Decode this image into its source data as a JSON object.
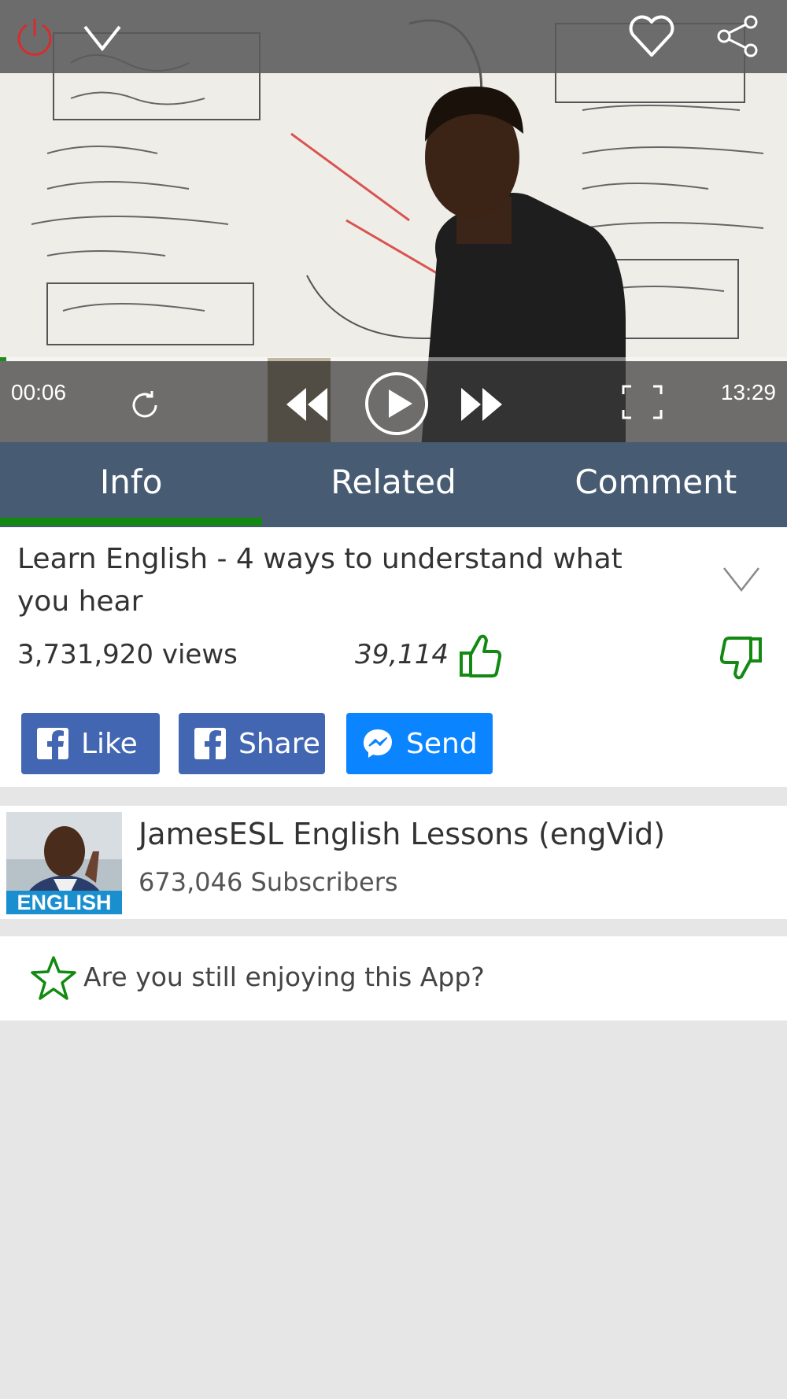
{
  "player": {
    "time_elapsed": "00:06",
    "time_total": "13:29",
    "progress_fraction": 0.008,
    "icons": {
      "power": "power-icon",
      "collapse": "chevron-down-icon",
      "favorite": "heart-icon",
      "share": "share-icon",
      "replay": "replay-icon",
      "rewind": "rewind-icon",
      "play": "play-icon",
      "forward": "fast-forward-icon",
      "fullscreen": "fullscreen-icon"
    }
  },
  "tabs": [
    {
      "label": "Info",
      "active": true
    },
    {
      "label": "Related",
      "active": false
    },
    {
      "label": "Comment",
      "active": false
    }
  ],
  "video": {
    "title": "Learn English - 4 ways to understand what you hear",
    "views": "3,731,920 views",
    "likes": "39,114"
  },
  "social_buttons": {
    "like": "Like",
    "share": "Share",
    "send": "Send"
  },
  "channel": {
    "name": "JamesESL English Lessons (engVid)",
    "subscribers": "673,046 Subscribers",
    "avatar_caption": "ENGLISH"
  },
  "rating_prompt": {
    "text": "Are you still enjoying this App?"
  },
  "colors": {
    "tab_bar": "#475b72",
    "accent_green": "#128a12",
    "facebook_blue": "#4266b2",
    "messenger_blue": "#0a84ff"
  }
}
